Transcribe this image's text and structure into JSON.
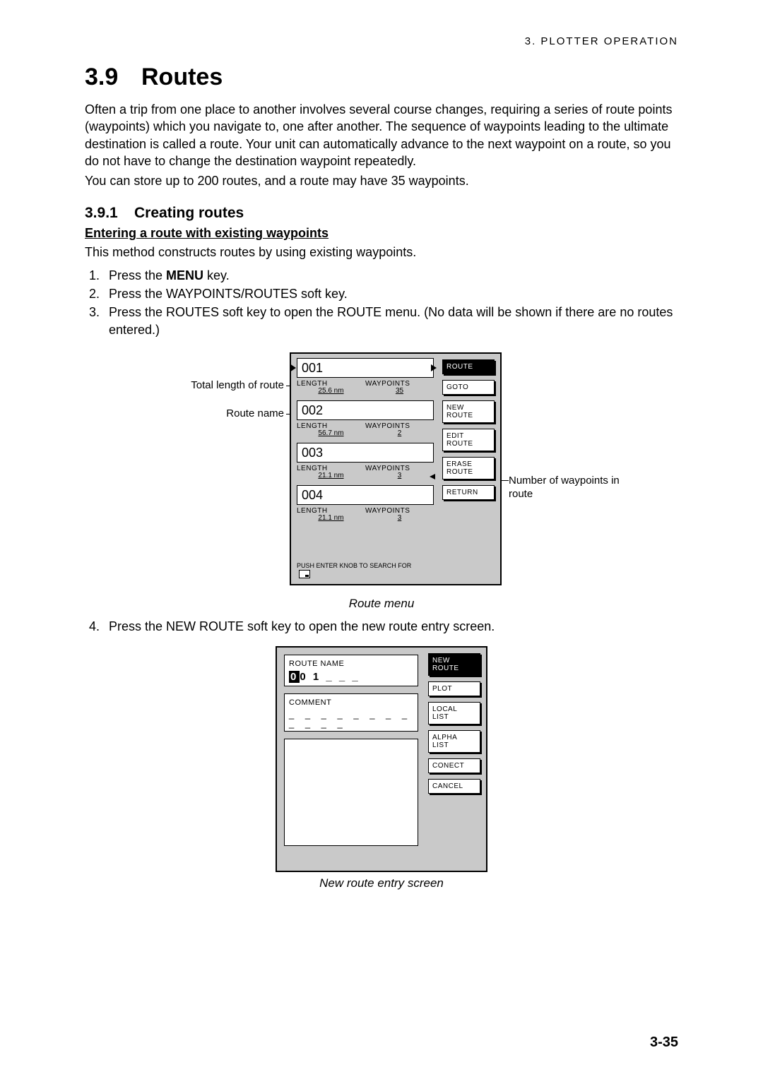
{
  "header": {
    "chapter": "3.  PLOTTER  OPERATION"
  },
  "section": {
    "num": "3.9",
    "title": "Routes"
  },
  "paragraphs": {
    "p1": "Often a trip from one place to another involves several course changes, requiring a series of route points (waypoints) which you navigate to, one after another. The sequence of waypoints leading to the ultimate destination is called a route. Your unit can automatically advance to the next waypoint on a route, so you do not have to change the destination waypoint repeatedly.",
    "p2": "You can store up to 200 routes, and a route may have 35 waypoints."
  },
  "subsection": {
    "num": "3.9.1",
    "title": "Creating routes"
  },
  "subhead": "Entering a route with existing waypoints",
  "lead": "This method constructs routes by using existing waypoints.",
  "steps1": {
    "s1a": "Press the ",
    "s1b": "MENU",
    "s1c": " key.",
    "s2": "Press the WAYPOINTS/ROUTES soft key.",
    "s3": "Press the ROUTES soft key to open the ROUTE menu. (No data will be shown if there are no routes entered.)"
  },
  "fig1": {
    "callouts": {
      "totalLength": "Total length of route",
      "routeName": "Route name",
      "numWaypoints": "Number of waypoints in route"
    },
    "meta": {
      "lengthLabel": "LENGTH",
      "waypointsLabel": "WAYPOINTS"
    },
    "routes": [
      {
        "name": "001",
        "length": "25.6 nm",
        "waypoints": "35"
      },
      {
        "name": "002",
        "length": "56.7 nm",
        "waypoints": "2"
      },
      {
        "name": "003",
        "length": "21.1 nm",
        "waypoints": "3"
      },
      {
        "name": "004",
        "length": "21.1 nm",
        "waypoints": "3"
      }
    ],
    "footer": "PUSH ENTER KNOB TO SEARCH FOR",
    "softkeys": [
      "ROUTE",
      "GOTO",
      "NEW\nROUTE",
      "EDIT\nROUTE",
      "ERASE\nROUTE",
      "RETURN"
    ],
    "caption": "Route menu"
  },
  "steps2": {
    "s4": "Press the NEW ROUTE soft key to open the new route entry screen."
  },
  "fig2": {
    "labels": {
      "routeName": "ROUTE NAME",
      "comment": "COMMENT"
    },
    "nameValue": {
      "cursor": "0",
      "rest": "0 1 _ _ _"
    },
    "commentValue": "_ _ _ _ _ _ _ _ _ _ _ _",
    "softkeys": [
      "NEW\nROUTE",
      "PLOT",
      "LOCAL\nLIST",
      "ALPHA\nLIST",
      "CONECT",
      "CANCEL"
    ],
    "caption": "New route entry screen"
  },
  "pageNumber": "3-35"
}
